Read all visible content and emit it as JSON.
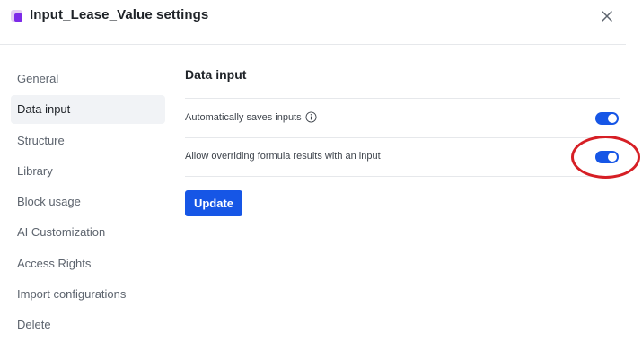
{
  "header": {
    "title": "Input_Lease_Value settings",
    "close_icon": "close-icon"
  },
  "sidebar": {
    "items": [
      {
        "label": "General",
        "active": false
      },
      {
        "label": "Data input",
        "active": true
      },
      {
        "label": "Structure",
        "active": false
      },
      {
        "label": "Library",
        "active": false
      },
      {
        "label": "Block usage",
        "active": false
      },
      {
        "label": "AI Customization",
        "active": false
      },
      {
        "label": "Access Rights",
        "active": false
      },
      {
        "label": "Import configurations",
        "active": false
      },
      {
        "label": "Delete",
        "active": false
      }
    ]
  },
  "main": {
    "section_title": "Data input",
    "settings": [
      {
        "label": "Automatically saves inputs",
        "has_info_icon": true,
        "enabled": true
      },
      {
        "label": "Allow overriding formula results with an input",
        "has_info_icon": false,
        "enabled": true
      }
    ],
    "update_label": "Update"
  },
  "colors": {
    "accent": "#1656e6",
    "highlight": "#d61f25",
    "brand_icon": "#7d2ae8"
  }
}
